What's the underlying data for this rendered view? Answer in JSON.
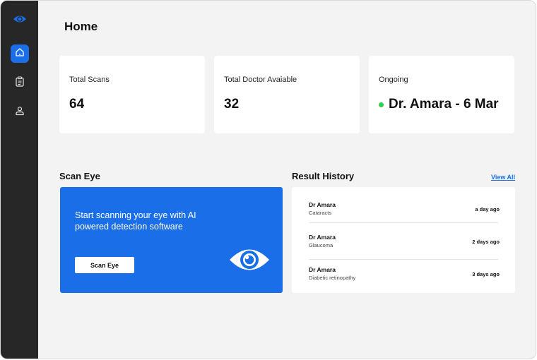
{
  "colors": {
    "accent": "#1a6fe8",
    "sidebar": "#272727",
    "status_online": "#2bd34d"
  },
  "sidebar": {
    "logo_icon": "eye-icon",
    "items": [
      {
        "icon": "home-icon",
        "active": true
      },
      {
        "icon": "clipboard-icon",
        "active": false
      },
      {
        "icon": "user-icon",
        "active": false
      }
    ]
  },
  "header": {
    "title": "Home"
  },
  "stats": [
    {
      "label": "Total Scans",
      "value": "64"
    },
    {
      "label": "Total Doctor Avaiable",
      "value": "32"
    },
    {
      "label": "Ongoing",
      "value": "Dr. Amara - 6 Mar"
    }
  ],
  "scan": {
    "title": "Scan Eye",
    "description": "Start scanning your eye with AI powered detection software",
    "button_label": "Scan Eye",
    "icon": "eye-icon"
  },
  "history": {
    "title": "Result History",
    "view_all": "View All",
    "items": [
      {
        "doctor": "Dr Amara",
        "condition": "Cataracts",
        "time": "a day ago"
      },
      {
        "doctor": "Dr Amara",
        "condition": "Glaucoma",
        "time": "2 days ago"
      },
      {
        "doctor": "Dr Amara",
        "condition": "Diabetic retinopathy",
        "time": "3 days ago"
      }
    ]
  }
}
